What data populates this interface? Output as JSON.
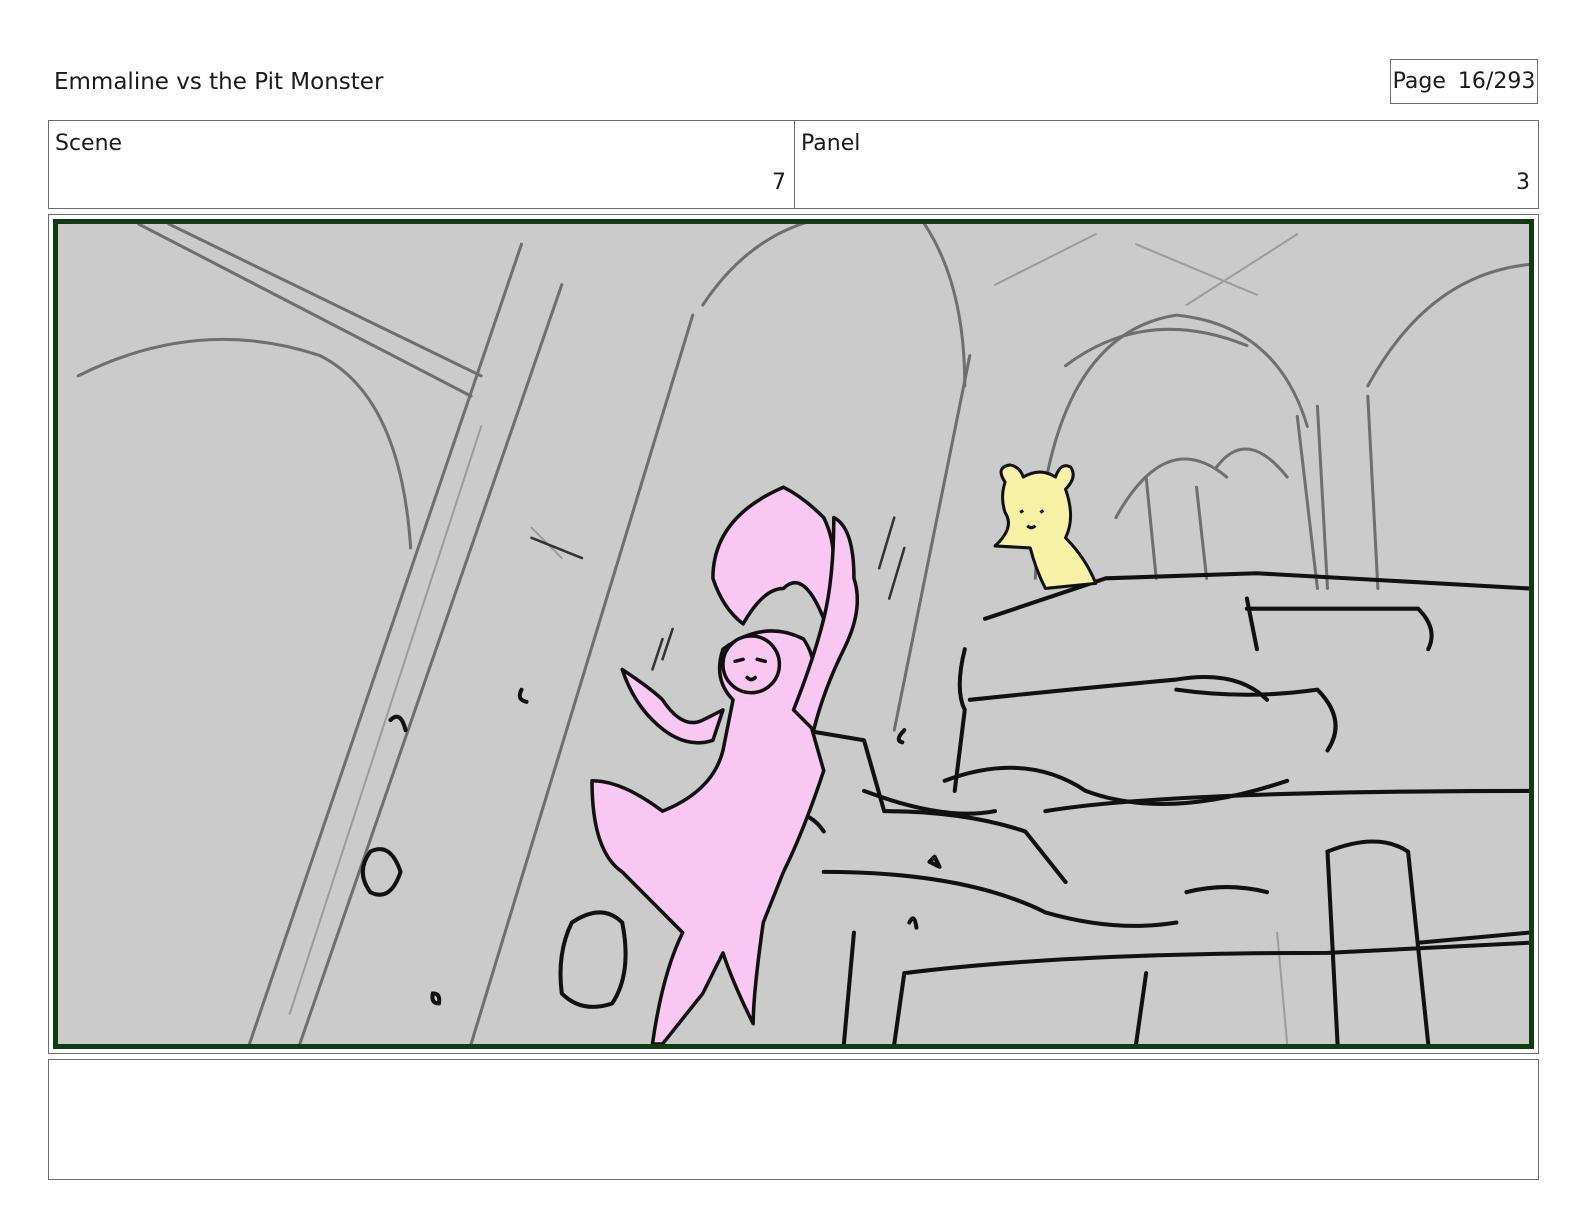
{
  "header": {
    "project_title": "Emmaline vs the Pit Monster",
    "page_label": "Page",
    "page_number": "16/293"
  },
  "info": {
    "scene_label": "Scene",
    "scene_value": "7",
    "panel_label": "Panel",
    "panel_value": "3"
  },
  "artwork": {
    "background_color": "#cbcbcb",
    "girl_fill_color": "#f9c8f2",
    "hamster_fill_color": "#f7f1a6",
    "frame_color": "#0f3d0f"
  },
  "notes": {
    "text": ""
  }
}
